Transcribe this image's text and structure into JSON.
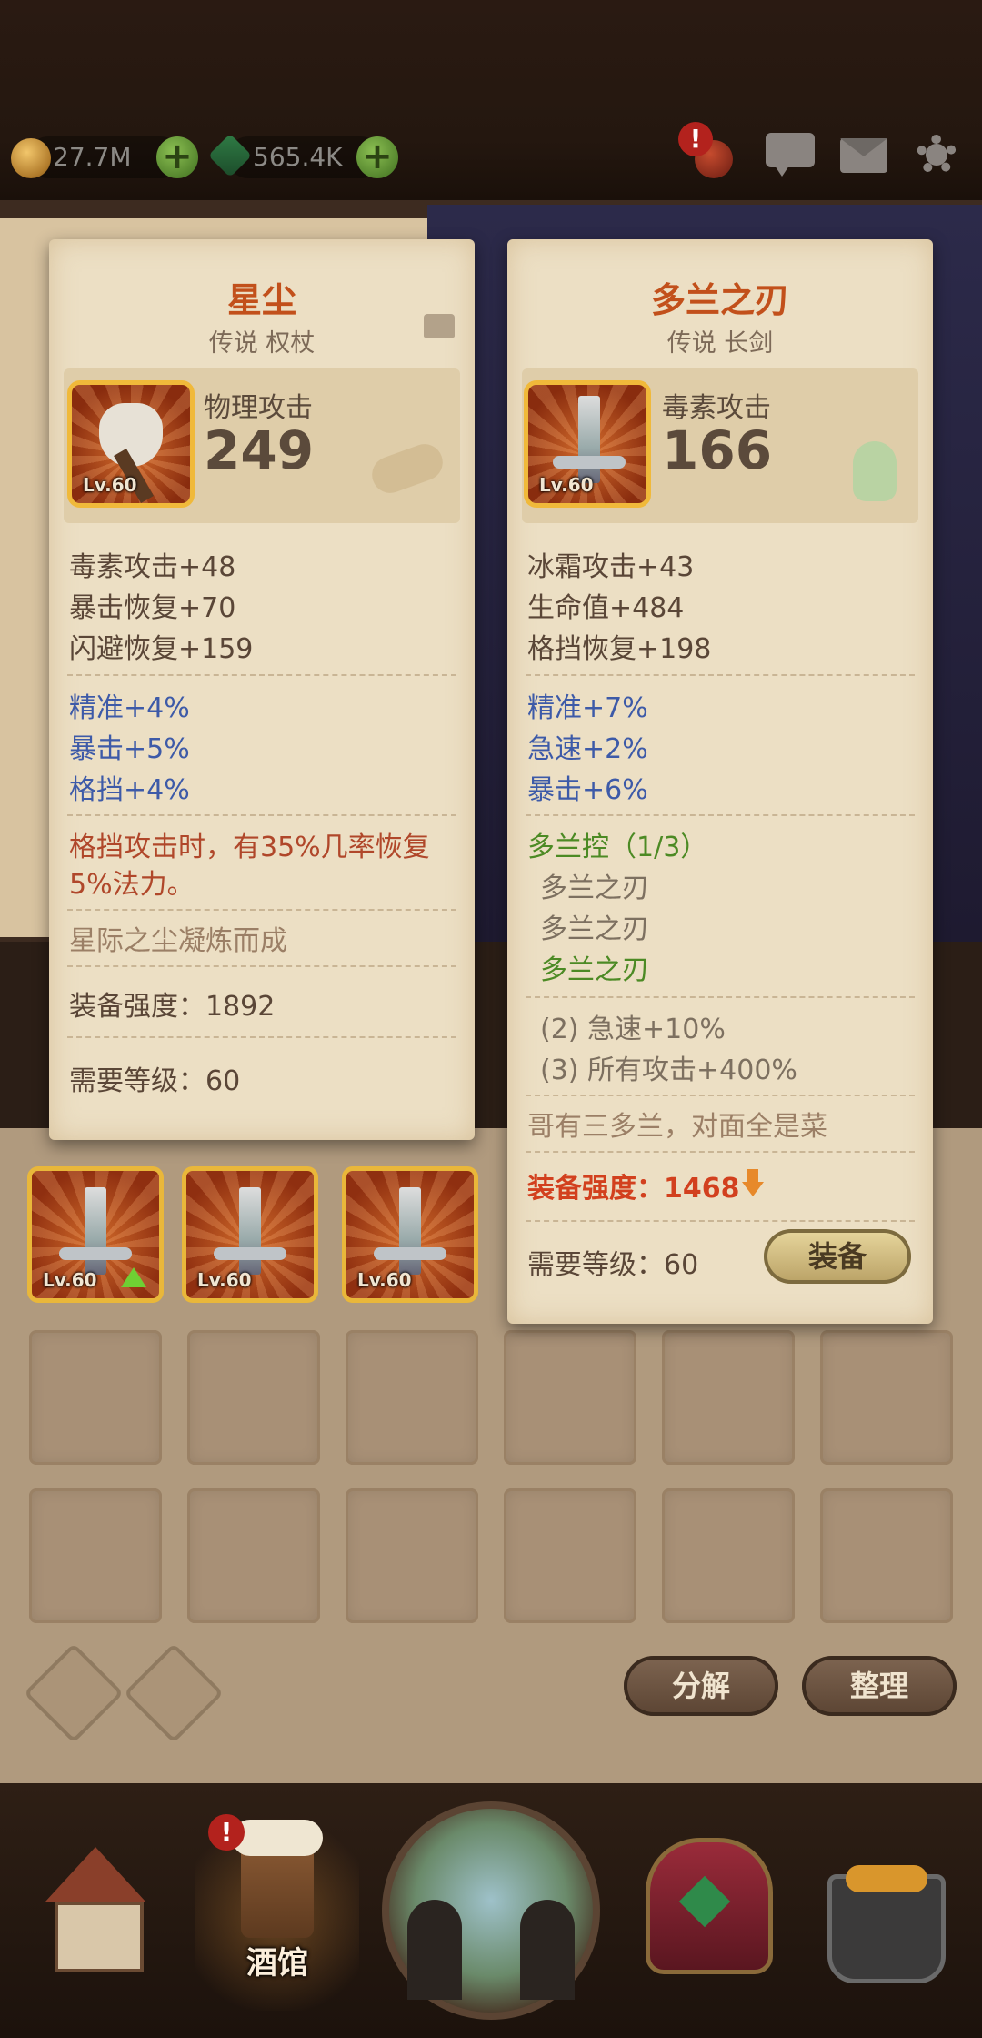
{
  "topbar": {
    "coins": "27.7M",
    "gems": "565.4K",
    "alert_mark": "!"
  },
  "items_row": [
    {
      "level": "Lv.60",
      "upgrade": true
    },
    {
      "level": "Lv.60",
      "upgrade": false
    },
    {
      "level": "Lv.60",
      "upgrade": false
    }
  ],
  "actions": {
    "decompose": "分解",
    "sort": "整理"
  },
  "nav": {
    "tavern_label": "酒馆",
    "alert_mark": "!"
  },
  "card_left": {
    "name": "星尘",
    "subtitle": "传说 权杖",
    "main_stat_label": "物理攻击",
    "main_stat_value": "249",
    "level": "Lv.60",
    "stats": [
      "毒素攻击+48",
      "暴击恢复+70",
      "闪避恢复+159"
    ],
    "percent_stats": [
      "精准+4%",
      "暴击+5%",
      "格挡+4%"
    ],
    "effect_line1": "格挡攻击时，有35%几率恢复",
    "effect_line2": "5%法力。",
    "flavor": "星际之尘凝炼而成",
    "power": "装备强度：1892",
    "req_level": "需要等级：60"
  },
  "card_right": {
    "name": "多兰之刃",
    "subtitle": "传说 长剑",
    "main_stat_label": "毒素攻击",
    "main_stat_value": "166",
    "level": "Lv.60",
    "stats": [
      "冰霜攻击+43",
      "生命值+484",
      "格挡恢复+198"
    ],
    "percent_stats": [
      "精准+7%",
      "急速+2%",
      "暴击+6%"
    ],
    "set_name": "多兰控（1/3）",
    "set_items": [
      "多兰之刃",
      "多兰之刃",
      "多兰之刃"
    ],
    "set_bonuses": [
      "(2) 急速+10%",
      "(3) 所有攻击+400%"
    ],
    "flavor": "哥有三多兰，对面全是菜",
    "power": "装备强度：1468",
    "req_level": "需要等级：60",
    "equip_button": "装备"
  },
  "colors": {
    "title": "#c2501b",
    "blue_stat": "#3d5aa8",
    "effect": "#b0472a",
    "set_green": "#4c8a24",
    "power_red": "#d2401e"
  }
}
